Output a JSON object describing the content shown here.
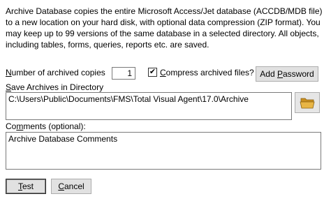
{
  "description": "Archive Database copies the entire Microsoft Access/Jet database (ACCDB/MDB file) to a new location on your hard disk, with optional data compression (ZIP format). You may keep up to 99 versions of the same database in a selected directory. All objects, including tables, forms, queries, reports etc. are saved.",
  "copies": {
    "label_key": "N",
    "label_rest": "umber of archived copies",
    "value": "1"
  },
  "compress": {
    "checked_mark": "✔",
    "label_key": "C",
    "label_rest": "ompress archived files?"
  },
  "add_password": {
    "label_pre": "Add ",
    "label_key": "P",
    "label_rest": "assword"
  },
  "directory": {
    "label_key": "S",
    "label_rest": "ave Archives in Directory",
    "value": "C:\\Users\\Public\\Documents\\FMS\\Total Visual Agent\\17.0\\Archive"
  },
  "comments": {
    "label_pre": "Co",
    "label_key": "m",
    "label_rest": "ments (optional):",
    "value": "Archive Database Comments"
  },
  "buttons": {
    "test_key": "T",
    "test_rest": "est",
    "cancel_key": "C",
    "cancel_rest": "ancel"
  },
  "colors": {
    "folder": "#e8b545",
    "button_bg": "#e1e1e1"
  }
}
